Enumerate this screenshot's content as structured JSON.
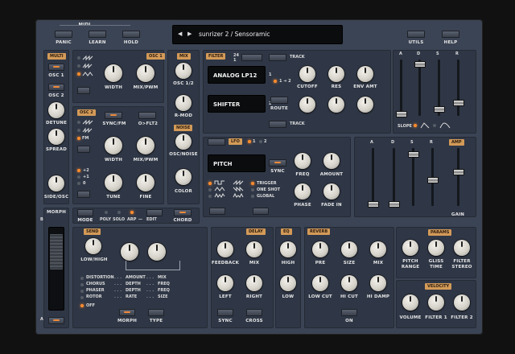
{
  "top": {
    "midi_label": "MIDI",
    "panic": "PANIC",
    "learn": "LEARN",
    "hold": "HOLD",
    "preset": "sunrizer 2 / Sensoramic",
    "utils": "UTILS",
    "help": "HELP"
  },
  "multi": {
    "label": "MULTI",
    "osc2": "OSC 2",
    "detune": "DETUNE",
    "spread": "SPREAD",
    "sideosc": "SIDE/OSC"
  },
  "osc1": {
    "title": "OSC 1",
    "width": "WIDTH",
    "mixpwm": "MIX/PWM"
  },
  "osc2": {
    "title": "OSC 2",
    "syncfm": "SYNC/FM",
    "flt2": "O>FLT2",
    "width": "WIDTH",
    "mixpwm": "MIX/PWM",
    "tune": "TUNE",
    "fine": "FINE",
    "fm": "FM",
    "octaves": [
      "+2",
      "+1",
      "0"
    ]
  },
  "mix": {
    "title": "MIX",
    "osc12": "OSC 1/2",
    "rmod": "R-MOD",
    "noise_title": "NOISE",
    "oscnoise": "OSC/NOISE",
    "color": "COLOR"
  },
  "filter": {
    "title": "FILTER",
    "track": "TRACK",
    "track2": "TRACK",
    "num24": "24",
    "num1": "1",
    "filter1": "ANALOG LP12",
    "filter2": "SHIFTER",
    "row1": "1",
    "row2": "2",
    "routing": "1 ➔ 2",
    "cutoff": "CUTOFF",
    "res": "RES",
    "envamt": "ENV AMT",
    "route": "ROUTE",
    "slope": "SLOPE"
  },
  "fenv": {
    "a": "A",
    "d": "D",
    "s": "S",
    "r": "R"
  },
  "lfo": {
    "title": "LFO",
    "one": "1",
    "two": "2",
    "target": "PITCH",
    "sync": "SYNC",
    "freq": "FREQ",
    "amount": "AMOUNT",
    "phase": "PHASE",
    "fadein": "FADE IN",
    "trigger": "TRIGGER",
    "oneshot": "ONE SHOT",
    "global": "GLOBAL"
  },
  "aenv": {
    "a": "A",
    "d": "D",
    "s": "S",
    "r": "R",
    "amp": "AMP",
    "gain": "GAIN"
  },
  "mode": {
    "mode": "MODE",
    "poly": "POLY",
    "solo": "SOLO",
    "arp": "ARP",
    "edit": "EDIT",
    "chord": "CHORD"
  },
  "morph": {
    "title": "MORPH",
    "b": "B",
    "a": "A"
  },
  "send": {
    "title": "SEND",
    "lowhigh": "LOW/HIGH"
  },
  "fx": {
    "rows": [
      [
        "DISTORTION",
        "AMOUNT",
        "MIX"
      ],
      [
        "CHORUS",
        "DEPTH",
        "FREQ"
      ],
      [
        "PHASER",
        "DEPTH",
        "FREQ"
      ],
      [
        "ROTOR",
        "RATE",
        "SIZE"
      ]
    ],
    "off": "OFF",
    "morph": "MORPH",
    "type": "TYPE"
  },
  "delay": {
    "title": "DELAY",
    "feedback": "FEEDBACK",
    "mix": "MIX",
    "left": "LEFT",
    "right": "RIGHT",
    "sync": "SYNC",
    "cross": "CROSS"
  },
  "eq": {
    "title": "EQ",
    "high": "HIGH",
    "low": "LOW"
  },
  "reverb": {
    "title": "REVERB",
    "pre": "PRE",
    "size": "SIZE",
    "mix": "MIX",
    "lowcut": "LOW CUT",
    "hicut": "HI CUT",
    "hidamp": "HI DAMP",
    "on": "ON"
  },
  "params": {
    "title": "PARAMS",
    "pitch": "PITCH",
    "range": "RANGE",
    "gliss": "GLISS",
    "time": "TIME",
    "filter": "FILTER",
    "stereo": "STEREO"
  },
  "velocity": {
    "title": "VELOCITY",
    "volume": "VOLUME",
    "filter1": "FILTER 1",
    "filter2": "FILTER 2"
  }
}
